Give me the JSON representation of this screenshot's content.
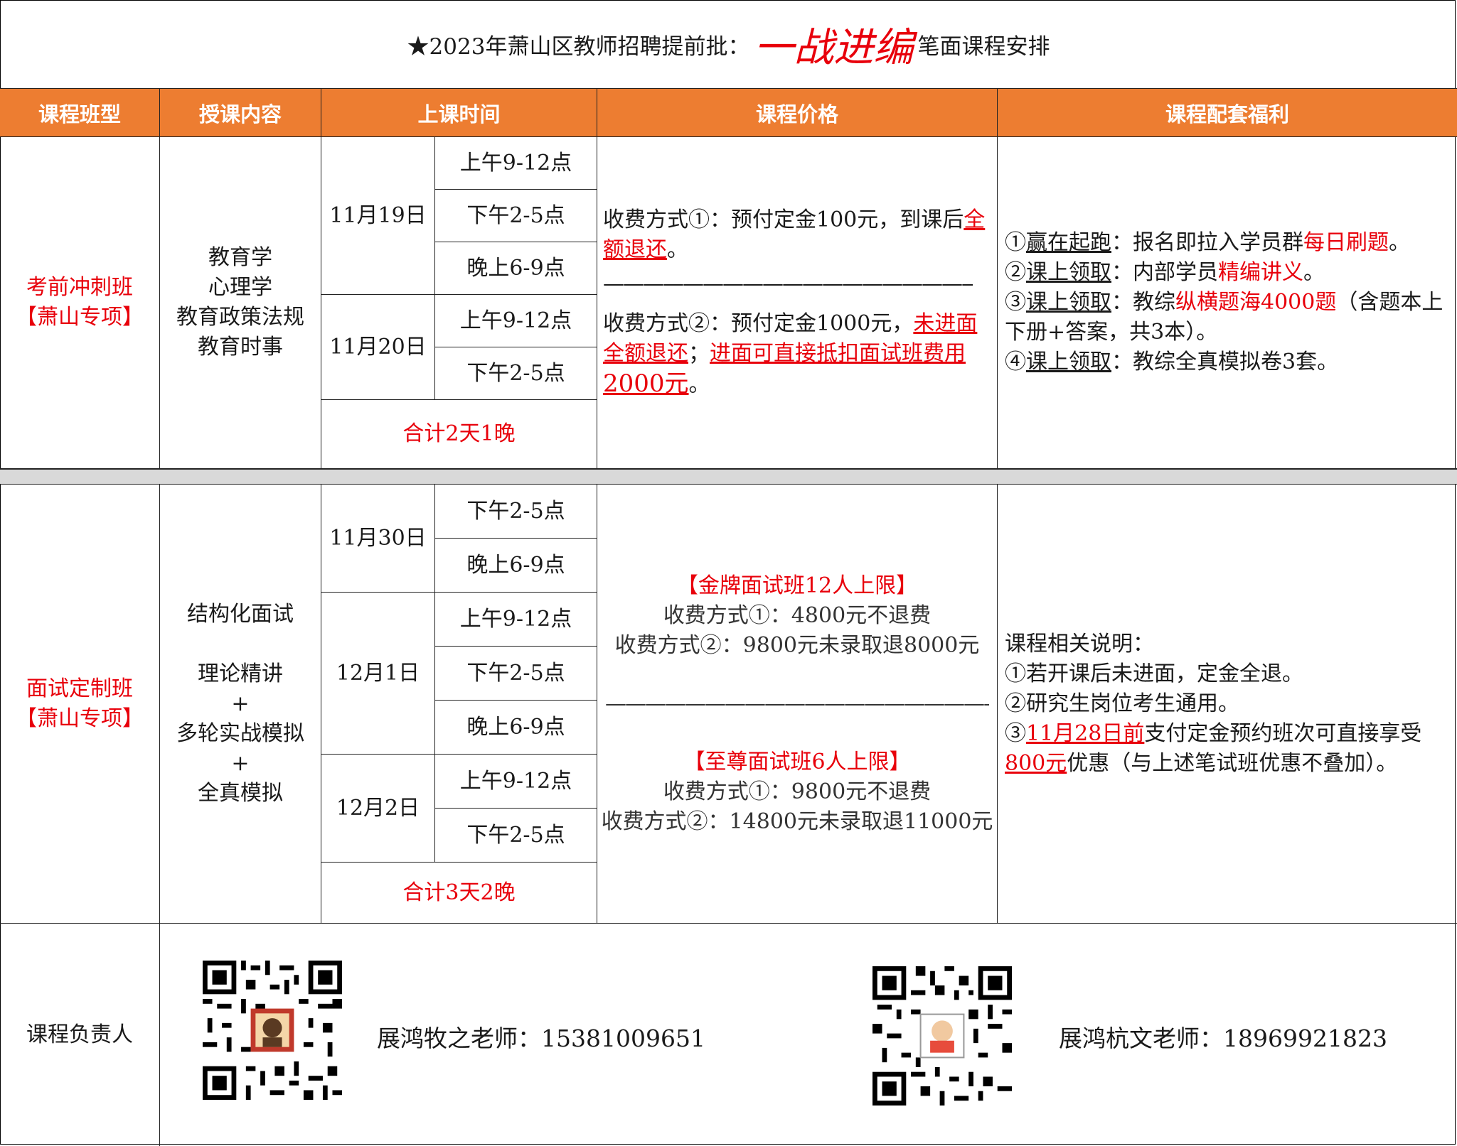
{
  "title": {
    "prefix": "★2023年萧山区教师招聘提前批：",
    "highlight": "一战进编",
    "suffix": "笔面课程安排"
  },
  "header": [
    "课程班型",
    "授课内容",
    "上课时间",
    "课程价格",
    "课程配套福利"
  ],
  "written": {
    "class_name": "考前冲刺班",
    "class_tag": "【萧山专项】",
    "content": [
      "教育学",
      "心理学",
      "教育政策法规",
      "教育时事"
    ],
    "days": [
      {
        "date": "11月19日",
        "slots": [
          "上午9-12点",
          "下午2-5点",
          "晚上6-9点"
        ]
      },
      {
        "date": "11月20日",
        "slots": [
          "上午9-12点",
          "下午2-5点"
        ]
      }
    ],
    "total": "合计2天1晚",
    "price1_a": "收费方式①：预付定金100元，到课后",
    "price1_b": "全额退还",
    "price1_c": "。",
    "divider": "——————————————————————",
    "price2_a": "收费方式②：预付定金1000元，",
    "price2_b": "未进面全额退还",
    "price2_c": "；",
    "price2_d": "进面可直接抵扣面试班费用",
    "price2_e": "2000元",
    "price2_f": "。",
    "benefits": [
      {
        "num": "①",
        "key": "赢在起跑",
        "a": "：报名即拉入学员群",
        "hl": "每日刷题",
        "b": "。"
      },
      {
        "num": "②",
        "key": "课上领取",
        "a": "：内部学员",
        "hl": "精编讲义",
        "b": "。"
      },
      {
        "num": "③",
        "key": "课上领取",
        "a": "：教综",
        "hl": "纵横题海4000题",
        "b": "（含题本上下册+答案，共3本）。"
      },
      {
        "num": "④",
        "key": "课上领取",
        "a": "：教综全真模拟卷3套。",
        "hl": "",
        "b": ""
      }
    ]
  },
  "interview": {
    "class_name": "面试定制班",
    "class_tag": "【萧山专项】",
    "content": [
      "结构化面试",
      "",
      "理论精讲",
      "+",
      "多轮实战模拟",
      "+",
      "全真模拟"
    ],
    "days": [
      {
        "date": "11月30日",
        "slots": [
          "下午2-5点",
          "晚上6-9点"
        ]
      },
      {
        "date": "12月1日",
        "slots": [
          "上午9-12点",
          "下午2-5点",
          "晚上6-9点"
        ]
      },
      {
        "date": "12月2日",
        "slots": [
          "上午9-12点",
          "下午2-5点"
        ]
      }
    ],
    "total": "合计3天2晚",
    "gold_title": "【金牌面试班12人上限】",
    "gold_p1": "收费方式①：4800元不退费",
    "gold_p2": "收费方式②：9800元未录取退8000元",
    "divider": "——————————————————————",
    "supreme_title": "【至尊面试班6人上限】",
    "supreme_p1": "收费方式①：9800元不退费",
    "supreme_p2": "收费方式②：14800元未录取退11000元",
    "notes_title": "课程相关说明：",
    "note1": "①若开课后未进面，定金全退。",
    "note2": "②研究生岗位考生通用。",
    "note3_a": "③",
    "note3_hl": "11月28日前",
    "note3_b": "支付定金预约班次可直接享受",
    "note3_hl2": "800元",
    "note3_c": "优惠（与上述笔试班优惠不叠加）。"
  },
  "footer": {
    "label": "课程负责人",
    "contact1": "展鸿牧之老师：15381009651",
    "contact2": "展鸿杭文老师：18969921823"
  },
  "colors": {
    "header_bg": "#ed7d31",
    "accent_red": "#e8000b",
    "separator": "#d9d9d9"
  }
}
